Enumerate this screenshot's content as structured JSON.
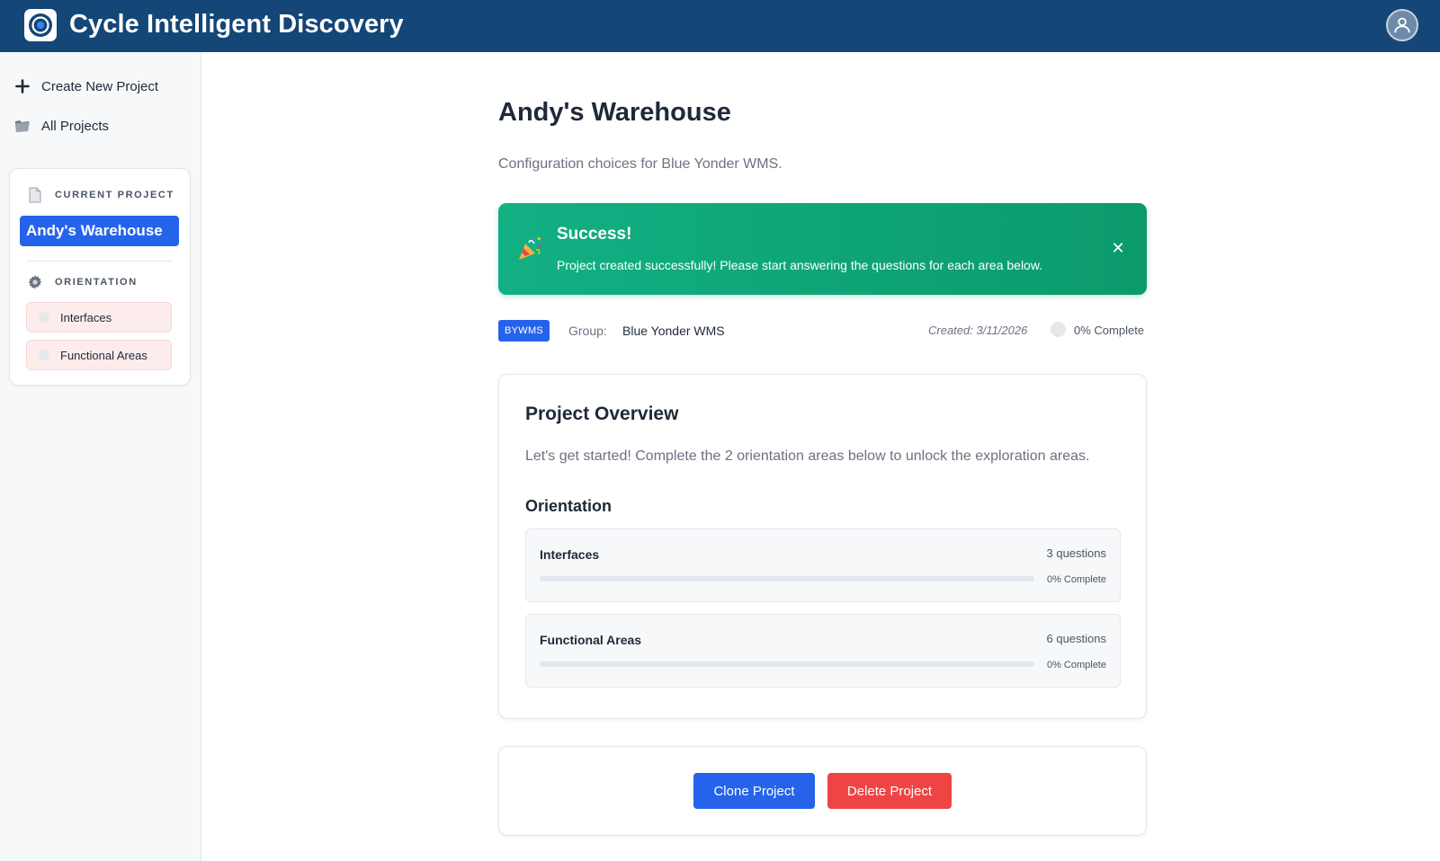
{
  "app": {
    "title": "Cycle Intelligent Discovery",
    "icons": {
      "logo": "target-logo-icon",
      "user": "user-icon"
    },
    "colors": {
      "header": "#144677",
      "primary": "#2563eb",
      "success": "#10a777",
      "danger": "#ef4444"
    }
  },
  "sidebar": {
    "create_label": "Create New Project",
    "all_projects_label": "All Projects",
    "current_project_heading": "CURRENT PROJECT",
    "current_project_name": "Andy's Warehouse",
    "orientation_heading": "ORIENTATION",
    "orientation_items": [
      {
        "label": "Interfaces"
      },
      {
        "label": "Functional Areas"
      }
    ]
  },
  "main": {
    "title": "Andy's Warehouse",
    "subtitle": "Configuration choices for Blue Yonder WMS.",
    "alert": {
      "title": "Success!",
      "message": "Project created successfully! Please start answering the questions for each area below.",
      "close": "✕"
    },
    "meta": {
      "badge": "BYWMS",
      "group_label": "Group:",
      "group_value": "Blue Yonder WMS",
      "created": "Created: 3/11/2026",
      "progress_text": "0% Complete",
      "progress_fraction": 0
    },
    "overview": {
      "title": "Project Overview",
      "description": "Let's get started! Complete the 2 orientation areas below to unlock the exploration areas.",
      "orientation_title": "Orientation",
      "areas": [
        {
          "name": "Interfaces",
          "count": "3 questions",
          "pct_text": "0% Complete",
          "progress": 0
        },
        {
          "name": "Functional Areas",
          "count": "6 questions",
          "pct_text": "0% Complete",
          "progress": 0
        }
      ]
    },
    "actions": {
      "clone_label": "Clone Project",
      "delete_label": "Delete Project"
    }
  }
}
